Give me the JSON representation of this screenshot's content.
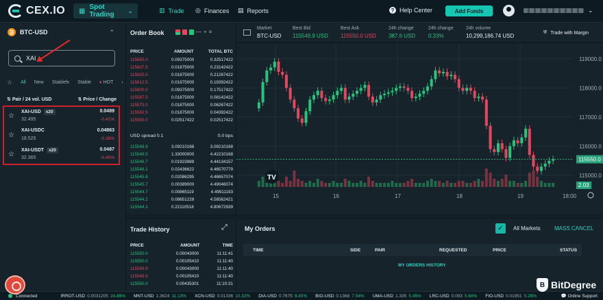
{
  "nav": {
    "logo": "CEX.IO",
    "spot_trading": "Spot Trading",
    "links": [
      "Trade",
      "Finances",
      "Reports"
    ],
    "help": "Help Center",
    "add_funds": "Add Funds"
  },
  "pair_panel": {
    "pair": "BTC-USD",
    "search_value": "XAI",
    "filters": [
      "All",
      "New",
      "Stablefx",
      "Stable",
      "HOT"
    ],
    "col_pair": "Pair / 24 vol. USD",
    "col_price": "Price / Change",
    "results": [
      {
        "name": "XAI-USD",
        "lev": "x20",
        "vol": "32.495",
        "price": "0.0489",
        "change": "-0.41%"
      },
      {
        "name": "XAI-USDC",
        "lev": "",
        "vol": "18.525",
        "price": "0.04863",
        "change": "-0.38%"
      },
      {
        "name": "XAI-USDT",
        "lev": "x20",
        "vol": "32.365",
        "price": "0.0487",
        "change": "-0.40%"
      }
    ]
  },
  "order_book": {
    "title": "Order Book",
    "headers": [
      "PRICE",
      "AMOUNT",
      "TOTAL BTC"
    ],
    "asks": [
      [
        "115650.0",
        "0.09375000",
        "0.32517422"
      ],
      [
        "115637.5",
        "0.01875000",
        "0.23142422"
      ],
      [
        "115625.0",
        "0.01875000",
        "0.21267422"
      ],
      [
        "115612.5",
        "0.01875000",
        "0.19392422"
      ],
      [
        "115600.0",
        "0.09375000",
        "0.17517422"
      ],
      [
        "115587.5",
        "0.01875000",
        "0.08142422"
      ],
      [
        "115575.0",
        "0.01875000",
        "0.06267422"
      ],
      [
        "115562.5",
        "0.01875000",
        "0.04392422"
      ],
      [
        "115550.0",
        "0.02517422",
        "0.02517422"
      ]
    ],
    "spread_label": "USD spread 0.1",
    "spread_bps": "0.0 bps",
    "bids": [
      [
        "115549.9",
        "3.09210168",
        "3.09210168"
      ],
      [
        "115549.0",
        "1.33000000",
        "4.42210168"
      ],
      [
        "115546.7",
        "0.01923989",
        "4.44134157"
      ],
      [
        "115546.1",
        "0.02436622",
        "4.46570779"
      ],
      [
        "115545.8",
        "0.02086295",
        "4.48657074"
      ],
      [
        "115545.7",
        "0.00389000",
        "4.49046074"
      ],
      [
        "115544.7",
        "0.00865119",
        "4.49911193"
      ],
      [
        "115544.2",
        "0.08651228",
        "4.58562421"
      ],
      [
        "115544.1",
        "0.22110518",
        "4.80672939"
      ]
    ]
  },
  "trade_history": {
    "title": "Trade History",
    "headers": [
      "PRICE",
      "AMOUNT",
      "TIME"
    ],
    "rows": [
      {
        "price": "115550.0",
        "amount": "0.00043000",
        "time": "11:11:41",
        "side": "bid"
      },
      {
        "price": "115550.0",
        "amount": "0.00105410",
        "time": "11:11:40",
        "side": "bid"
      },
      {
        "price": "115549.9",
        "amount": "0.00043000",
        "time": "11:11:40",
        "side": "ask"
      },
      {
        "price": "115549.9",
        "amount": "0.00105410",
        "time": "11:11:40",
        "side": "ask"
      },
      {
        "price": "115550.0",
        "amount": "0.00435301",
        "time": "11:10:31",
        "side": "bid"
      }
    ]
  },
  "market": {
    "stats": [
      {
        "label": "Market",
        "value": "BTC-USD",
        "color": "#e6edf1"
      },
      {
        "label": "Best Bid",
        "value": "115549.9 USD",
        "color": "#26c47c"
      },
      {
        "label": "Best Ask",
        "value": "115550.0 USD",
        "color": "#e0485f"
      },
      {
        "label": "24h change",
        "value": "387.6 USD",
        "color": "#26c47c"
      },
      {
        "label": "24h change",
        "value": "0.33%",
        "color": "#26c47c"
      },
      {
        "label": "24h volume",
        "value": "10,299,186.74 USD",
        "color": "#e6edf1"
      }
    ],
    "trade_margin": "Trade with Margin"
  },
  "chart_data": {
    "type": "line",
    "y_ticks": [
      "119000.0",
      "118000.0",
      "117000.0",
      "116000.0",
      "115000.0"
    ],
    "ylim": [
      114600,
      119300
    ],
    "x_ticks": [
      "15",
      "16",
      "17",
      "18",
      "19",
      "18:00"
    ],
    "last_price_label": "115550.0",
    "volume_label": "2.03",
    "close_series": [
      117500,
      118200,
      118600,
      118700,
      118900,
      118550,
      118450,
      118000,
      117600,
      117300,
      116950,
      116800,
      117200,
      117600,
      117750,
      117900,
      117650,
      117550,
      117600,
      117750,
      117900,
      118000,
      117600,
      117700,
      117800,
      117900,
      118000,
      118100,
      117700,
      117500,
      117600,
      117750,
      117800,
      117850,
      117900,
      118000,
      118050,
      118000,
      117900,
      117650,
      117700,
      117800,
      117900,
      118050,
      118300,
      118600,
      118500,
      118550,
      118400,
      118450,
      118300,
      118000,
      117900,
      118000,
      117900,
      117650,
      117700,
      117600,
      116700,
      115900,
      115800,
      116100,
      115900,
      115600,
      116000,
      116200,
      116100,
      116300,
      116600,
      115700,
      115300,
      115150,
      115300,
      115400,
      115500,
      115550
    ],
    "volume_series": [
      3,
      5,
      2,
      6,
      4,
      3,
      2,
      5,
      3,
      8,
      4,
      3,
      2,
      3,
      2,
      4,
      3,
      2,
      2,
      3,
      2,
      2,
      4,
      3,
      2,
      2,
      3,
      2,
      5,
      3,
      2,
      2,
      2,
      2,
      3,
      2,
      2,
      2,
      3,
      4,
      2,
      2,
      2,
      3,
      4,
      3,
      3,
      2,
      3,
      2,
      2,
      3,
      3,
      2,
      2,
      3,
      4,
      3,
      9,
      7,
      4,
      3,
      4,
      6,
      3,
      3,
      2,
      2,
      3,
      7,
      8,
      5,
      3,
      2,
      2,
      2
    ]
  },
  "orders": {
    "title": "My Orders",
    "all_markets": "All Markets",
    "mass_cancel": "MASS CANCEL",
    "headers": [
      "TIME",
      "SIDE",
      "PAIR",
      "REQUESTED",
      "PRICE",
      "STATUS"
    ],
    "history_link": "MY ORDERS HISTORY"
  },
  "ticker": {
    "connected": "Connected",
    "items": [
      {
        "pair": "IRROT-USD",
        "price": "0.0031205",
        "change": "24.88%"
      },
      {
        "pair": "MNT-USD",
        "price": "1.3624",
        "change": "11.13%"
      },
      {
        "pair": "XCN-USD",
        "price": "0.01336",
        "change": "10.32%"
      },
      {
        "pair": "DIA-USD",
        "price": "0.7675",
        "change": "9.45%"
      },
      {
        "pair": "BIO-USD",
        "price": "0.1368",
        "change": "7.54%"
      },
      {
        "pair": "UMA-USD",
        "price": "1.335",
        "change": "5.45%"
      },
      {
        "pair": "LRC-USD",
        "price": "0.093",
        "change": "5.68%"
      },
      {
        "pair": "FIO-USD",
        "price": "0.01951",
        "change": "5.28%"
      }
    ],
    "online_support": "Online Support"
  },
  "watermark": "BitDegree"
}
